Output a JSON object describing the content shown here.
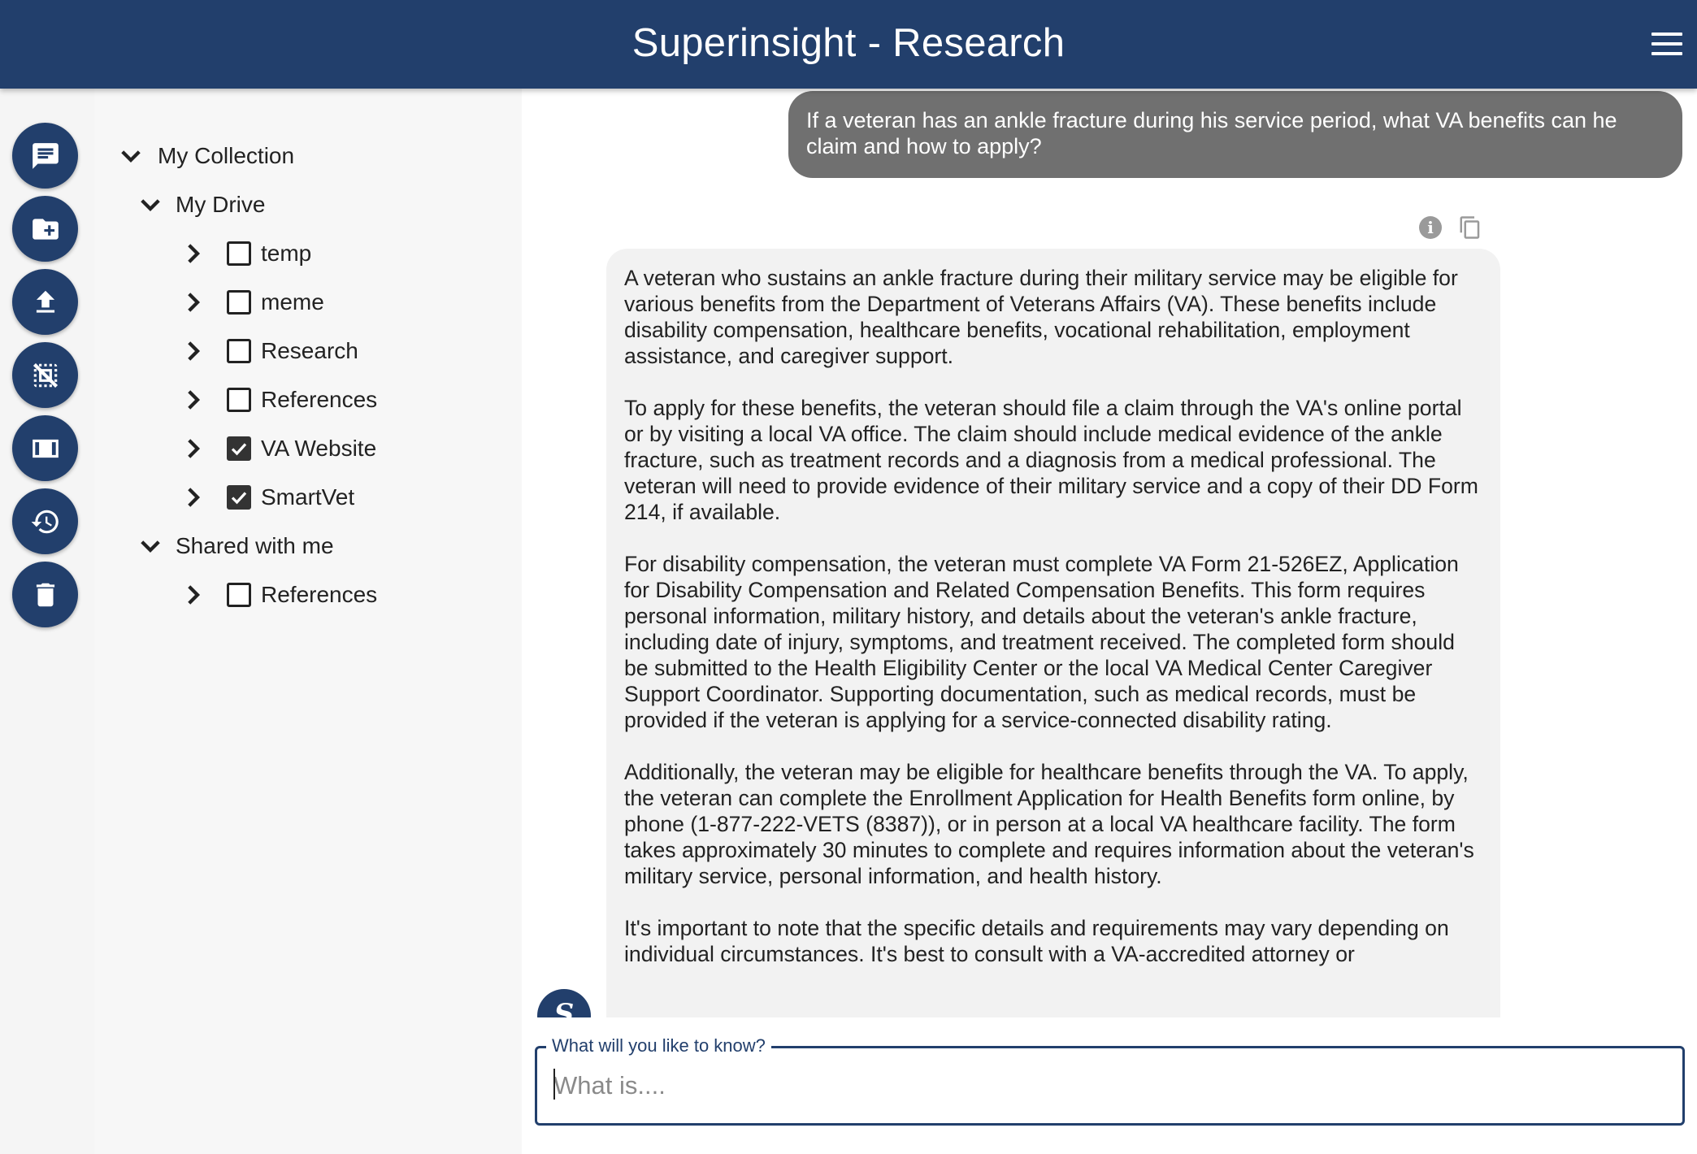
{
  "header": {
    "title": "Superinsight - Research",
    "menu_icon": "hamburger-menu-icon",
    "color": "#223f6c"
  },
  "rail": {
    "buttons": [
      {
        "name": "chat-button",
        "icon": "chat-icon"
      },
      {
        "name": "new-folder-button",
        "icon": "folder-plus-icon"
      },
      {
        "name": "upload-button",
        "icon": "upload-icon"
      },
      {
        "name": "deselect-button",
        "icon": "deselect-icon"
      },
      {
        "name": "panel-button",
        "icon": "panel-icon"
      },
      {
        "name": "history-button",
        "icon": "history-icon"
      },
      {
        "name": "delete-button",
        "icon": "trash-icon"
      }
    ]
  },
  "tree": {
    "root_label": "My Collection",
    "my_drive_label": "My Drive",
    "my_drive_items": [
      {
        "label": "temp",
        "checked": false
      },
      {
        "label": "meme",
        "checked": false
      },
      {
        "label": "Research",
        "checked": false
      },
      {
        "label": "References",
        "checked": false
      },
      {
        "label": "VA Website",
        "checked": true
      },
      {
        "label": "SmartVet",
        "checked": true
      }
    ],
    "shared_label": "Shared with me",
    "shared_items": [
      {
        "label": "References",
        "checked": false
      }
    ]
  },
  "chat": {
    "user_message": "If a veteran has an ankle fracture during his service period, what VA benefits can he claim and how to apply?",
    "bot_paragraphs": [
      "A veteran who sustains an ankle fracture during their military service may be eligible for various benefits from the Department of Veterans Affairs (VA). These benefits include disability compensation, healthcare benefits, vocational rehabilitation, employment assistance, and caregiver support.",
      "To apply for these benefits, the veteran should file a claim through the VA's online portal or by visiting a local VA office. The claim should include medical evidence of the ankle fracture, such as treatment records and a diagnosis from a medical professional. The veteran will need to provide evidence of their military service and a copy of their DD Form 214, if available.",
      "For disability compensation, the veteran must complete VA Form 21-526EZ, Application for Disability Compensation and Related Compensation Benefits. This form requires personal information, military history, and details about the veteran's ankle fracture, including date of injury, symptoms, and treatment received. The completed form should be submitted to the Health Eligibility Center or the local VA Medical Center Caregiver Support Coordinator. Supporting documentation, such as medical records, must be provided if the veteran is applying for a service-connected disability rating.",
      "Additionally, the veteran may be eligible for healthcare benefits through the VA. To apply, the veteran can complete the Enrollment Application for Health Benefits form online, by phone (1-877-222-VETS (8387)), or in person at a local VA healthcare facility. The form takes approximately 30 minutes to complete and requires information about the veteran's military service, personal information, and health history.",
      "It's important to note that the specific details and requirements may vary depending on individual circumstances. It's best to consult with a VA-accredited attorney or"
    ],
    "avatar_letter": "S",
    "info_icon": "info-icon",
    "copy_icon": "copy-icon"
  },
  "input": {
    "label": "What will you like to know?",
    "placeholder": "What is....",
    "value": ""
  }
}
